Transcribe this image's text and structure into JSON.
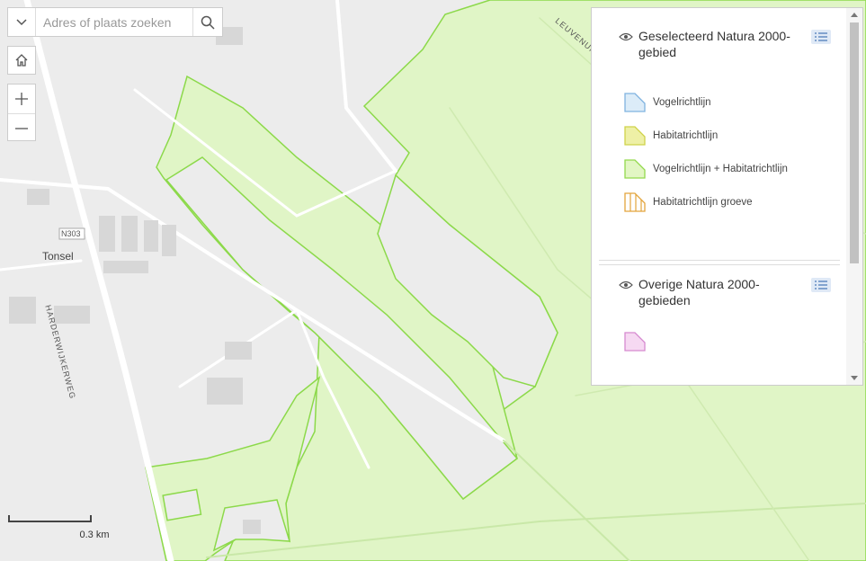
{
  "search": {
    "placeholder": "Adres of plaats zoeken"
  },
  "map_labels": {
    "town": "Tonsel",
    "road_shield": "N303",
    "road_main": "HARDERWIJKERWEG",
    "road_ne": "LEUVENUM"
  },
  "scale": {
    "label": "0.3 km"
  },
  "legend": {
    "sections": [
      {
        "title": "Geselecteerd Natura 2000-gebied",
        "items": [
          {
            "label": "Vogelrichtlijn",
            "fill": "#dcecf8",
            "stroke": "#7fb3e0",
            "pattern": "solid"
          },
          {
            "label": "Habitatrichtlijn",
            "fill": "#eef0a6",
            "stroke": "#cfd24a",
            "pattern": "solid"
          },
          {
            "label": "Vogelrichtlijn + Habitatrichtlijn",
            "fill": "#e2f6c4",
            "stroke": "#93d94d",
            "pattern": "solid"
          },
          {
            "label": "Habitatrichtlijn groeve",
            "fill": "#ffffff",
            "stroke": "#e3a53c",
            "pattern": "hatch"
          }
        ]
      },
      {
        "title": "Overige Natura 2000-gebieden",
        "items": [
          {
            "label": "",
            "fill": "#f6d9f2",
            "stroke": "#d68ad0",
            "pattern": "solid"
          }
        ]
      }
    ]
  },
  "colors": {
    "natura": "#e0f5c6",
    "natura_border": "#8cd94a",
    "urban": "#ececec",
    "roads": "#ffffff",
    "buildings": "#d4d4d4"
  },
  "icons": {
    "dropdown": "chevron-down-icon",
    "search": "search-icon",
    "home": "home-icon",
    "zoom_in": "plus-icon",
    "zoom_out": "minus-icon",
    "visibility": "eye-icon",
    "layer_menu": "list-icon"
  }
}
